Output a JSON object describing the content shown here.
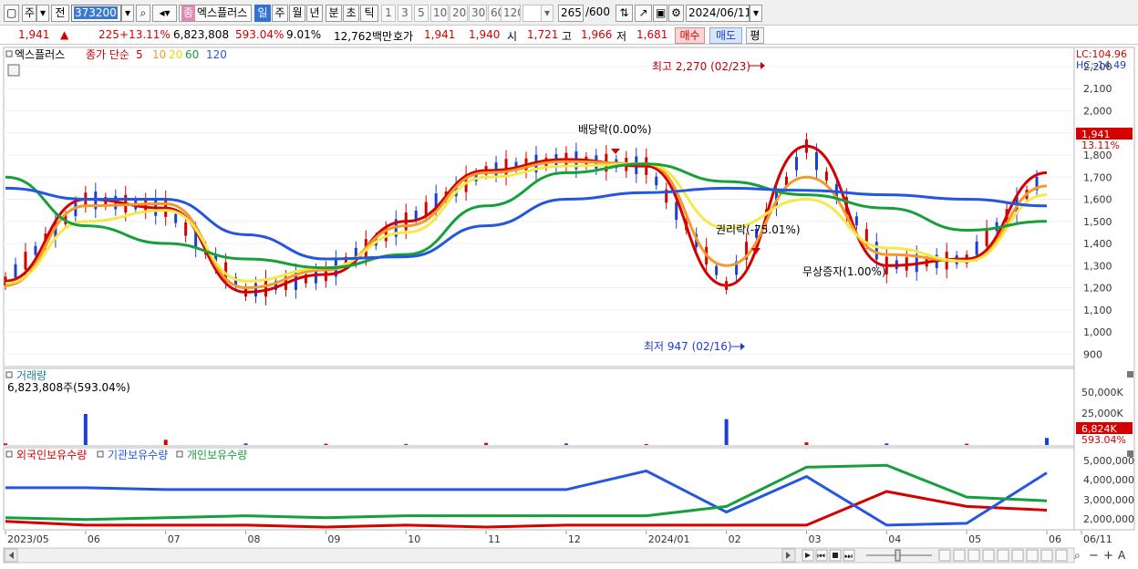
{
  "toolbar": {
    "market": "주",
    "prev_label": "전",
    "code": "373200",
    "stock_name_tag": "종",
    "stock_name": "엑스플러스",
    "periods": [
      "일",
      "주",
      "월",
      "년",
      "분",
      "초",
      "틱"
    ],
    "period_selected": "일",
    "intervals": [
      "1",
      "3",
      "5",
      "10",
      "20",
      "30",
      "60",
      "120"
    ],
    "count": "265",
    "count_total": "/600",
    "date": "2024/06/11"
  },
  "quote": {
    "price": "1,941",
    "change_arrow": "▲",
    "change": "225",
    "change_pct": "+13.11%",
    "volume": "6,823,808",
    "volume_ratio": "593.04%",
    "turnover": "9.01%",
    "amount": "12,762백만",
    "bid_label": "호가",
    "ask": "1,941",
    "bid": "1,940",
    "open_label": "시",
    "open": "1,721",
    "high_label": "고",
    "high": "1,966",
    "low_label": "저",
    "low": "1,681",
    "buy_button": "매수",
    "sell_button": "매도",
    "avg_button": "평"
  },
  "price_panel": {
    "stock_label": "엑스플러스",
    "ma_label": "종가 단순",
    "ma_periods": [
      "5",
      "10",
      "20",
      "60",
      "120"
    ],
    "ma_colors": [
      "#d50000",
      "#f39a2b",
      "#f5e94a",
      "#179f3c",
      "#2456e0"
    ],
    "lc": "LC:104.96",
    "hc": "HC:-14.49",
    "y_ticks": [
      "2,200",
      "2,100",
      "2,000",
      "1,900",
      "1,800",
      "1,700",
      "1,600",
      "1,500",
      "1,400",
      "1,300",
      "1,200",
      "1,100",
      "1,000",
      "900"
    ],
    "current_price_label": "1,941",
    "current_change_label": "13.11%",
    "annotations": {
      "high": "최고 2,270 (02/23)",
      "low": "최저 947 (02/16)",
      "dividend": "배당락(0.00%)",
      "rights": "권리락(-75.01%)",
      "bonus": "무상증자(1.00%)"
    }
  },
  "volume_panel": {
    "title": "거래량",
    "value": "6,823,808주(593.04%)",
    "y_ticks": [
      "50,000K",
      "25,000K"
    ],
    "current_label": "6,824K",
    "current_pct": "593.04%"
  },
  "holding_panel": {
    "series": [
      {
        "name": "외국인보유수량",
        "color": "#d50000"
      },
      {
        "name": "기관보유수량",
        "color": "#2456e0"
      },
      {
        "name": "개인보유수량",
        "color": "#179f3c"
      }
    ],
    "y_ticks": [
      "5,000,000",
      "4,000,000",
      "3,000,000",
      "2,000,000"
    ]
  },
  "x_axis": [
    "2023/05",
    "06",
    "07",
    "08",
    "09",
    "10",
    "11",
    "12",
    "2024/01",
    "02",
    "03",
    "04",
    "05",
    "06",
    "06/11"
  ],
  "chart_data": [
    {
      "type": "line",
      "title": "",
      "x": [
        "2023/05",
        "06",
        "07",
        "08",
        "09",
        "10",
        "11",
        "12",
        "2024/01",
        "02",
        "03",
        "04",
        "05",
        "06"
      ],
      "series": [
        {
          "name": "5",
          "values": [
            1230,
            1600,
            1560,
            1180,
            1260,
            1500,
            1730,
            1780,
            1750,
            1210,
            1840,
            1300,
            1330,
            1720
          ]
        },
        {
          "name": "10",
          "values": [
            1210,
            1570,
            1580,
            1200,
            1280,
            1480,
            1720,
            1770,
            1760,
            1300,
            1700,
            1350,
            1320,
            1660
          ]
        },
        {
          "name": "20",
          "values": [
            1220,
            1500,
            1550,
            1230,
            1290,
            1450,
            1700,
            1750,
            1760,
            1470,
            1600,
            1380,
            1320,
            1620
          ]
        },
        {
          "name": "60",
          "values": [
            1700,
            1480,
            1400,
            1330,
            1290,
            1350,
            1570,
            1720,
            1760,
            1680,
            1620,
            1560,
            1460,
            1500
          ]
        },
        {
          "name": "120",
          "values": [
            1650,
            1600,
            1600,
            1440,
            1330,
            1340,
            1480,
            1600,
            1630,
            1650,
            1640,
            1620,
            1600,
            1570
          ]
        }
      ],
      "ylim": [
        860,
        2270
      ]
    },
    {
      "type": "bar",
      "title": "거래량",
      "x": [
        "2023/05",
        "06",
        "07",
        "08",
        "09",
        "10",
        "11",
        "12",
        "2024/01",
        "02",
        "03",
        "04",
        "05",
        "06"
      ],
      "values": [
        1500,
        30000,
        5000,
        1500,
        1200,
        1000,
        2000,
        1500,
        900,
        25000,
        2500,
        1500,
        1200,
        6824
      ],
      "ylim": [
        0,
        60000
      ]
    },
    {
      "type": "line",
      "title": "",
      "x": [
        "2023/05",
        "06",
        "07",
        "08",
        "09",
        "10",
        "11",
        "12",
        "2024/01",
        "02",
        "03",
        "04",
        "05",
        "06"
      ],
      "series": [
        {
          "name": "외국인보유수량",
          "values": [
            1900000,
            1700000,
            1700000,
            1700000,
            1600000,
            1700000,
            1600000,
            1700000,
            1700000,
            1700000,
            1700000,
            3500000,
            2700000,
            2500000
          ]
        },
        {
          "name": "기관보유수량",
          "values": [
            3700000,
            3700000,
            3600000,
            3600000,
            3600000,
            3600000,
            3600000,
            3600000,
            4600000,
            2400000,
            4300000,
            1700000,
            1800000,
            4500000
          ]
        },
        {
          "name": "개인보유수량",
          "values": [
            2100000,
            2000000,
            2100000,
            2200000,
            2100000,
            2200000,
            2200000,
            2200000,
            2200000,
            2700000,
            4800000,
            4900000,
            3200000,
            3000000
          ]
        }
      ],
      "ylim": [
        1500000,
        5400000
      ]
    }
  ]
}
